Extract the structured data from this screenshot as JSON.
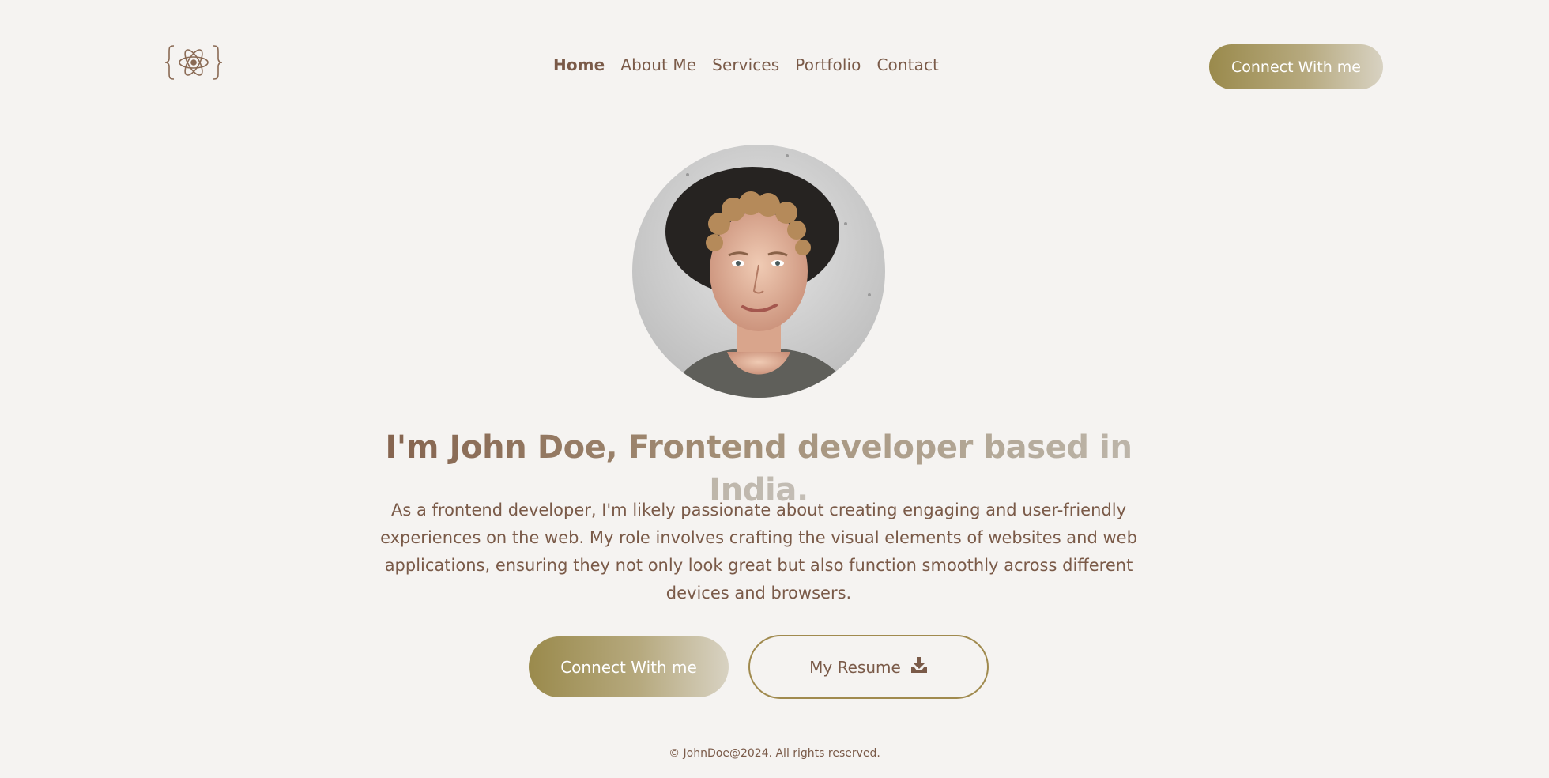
{
  "header": {
    "logo_icon": "react-atom-braces-icon",
    "nav": [
      {
        "label": "Home",
        "active": true
      },
      {
        "label": "About Me",
        "active": false
      },
      {
        "label": "Services",
        "active": false
      },
      {
        "label": "Portfolio",
        "active": false
      },
      {
        "label": "Contact",
        "active": false
      }
    ],
    "cta_label": "Connect With me"
  },
  "hero": {
    "avatar_alt": "profile-photo",
    "headline": "I'm John Doe, Frontend developer based in India.",
    "bio": "As a frontend developer, I'm likely passionate about creating engaging and user-friendly experiences on the web. My role involves crafting the visual elements of websites and web applications, ensuring they not only look great but also function smoothly across different devices and browsers.",
    "cta_label": "Connect With me",
    "resume_label": "My Resume",
    "resume_icon": "download-icon"
  },
  "footer": {
    "copyright": "© JohnDoe@2024. All rights reserved."
  },
  "colors": {
    "background": "#f5f3f1",
    "text": "#7a5a48",
    "accent_start": "#9a8a4c",
    "accent_end": "#d8d2c2"
  }
}
